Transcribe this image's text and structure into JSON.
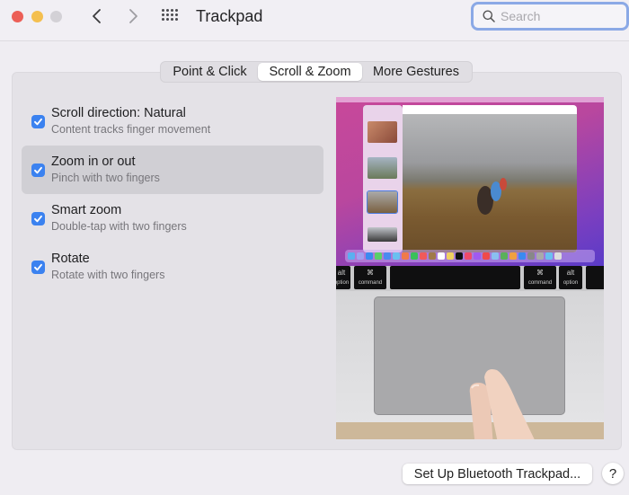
{
  "window": {
    "title": "Trackpad",
    "search_placeholder": "Search"
  },
  "tabs": [
    {
      "label": "Point & Click",
      "selected": false
    },
    {
      "label": "Scroll & Zoom",
      "selected": true
    },
    {
      "label": "More Gestures",
      "selected": false
    }
  ],
  "options": [
    {
      "title": "Scroll direction: Natural",
      "subtitle": "Content tracks finger movement",
      "checked": true,
      "selected": false
    },
    {
      "title": "Zoom in or out",
      "subtitle": "Pinch with two fingers",
      "checked": true,
      "selected": true
    },
    {
      "title": "Smart zoom",
      "subtitle": "Double-tap with two fingers",
      "checked": true,
      "selected": false
    },
    {
      "title": "Rotate",
      "subtitle": "Rotate with two fingers",
      "checked": true,
      "selected": false
    }
  ],
  "preview": {
    "keys": [
      {
        "symbol": "alt",
        "label": "option"
      },
      {
        "symbol": "⌘",
        "label": "command"
      },
      {
        "symbol": "⌘",
        "label": "command"
      },
      {
        "symbol": "alt",
        "label": "option"
      }
    ]
  },
  "footer": {
    "setup_button": "Set Up Bluetooth Trackpad...",
    "help_button": "?"
  },
  "colors": {
    "accent": "#3b82f0",
    "search_focus_ring": "#8ba9e6"
  }
}
